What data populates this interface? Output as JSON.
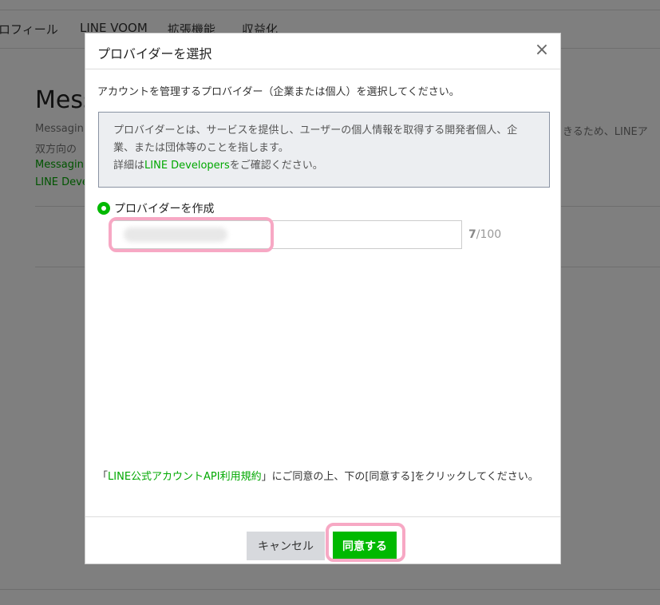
{
  "background": {
    "nav": [
      "ロフィール",
      "LINE VOOM",
      "拡張機能",
      "収益化"
    ],
    "title": "Mess",
    "desc_line1": "Messagin",
    "desc_line2": "双方向の",
    "desc_right": "きるため、LINEア",
    "link1": "Messagin",
    "link2": "LINE Deve"
  },
  "modal": {
    "title": "プロバイダーを選択",
    "close_icon": "×",
    "intro": "アカウントを管理するプロバイダー（企業または個人）を選択してください。",
    "info": {
      "text": "プロバイダーとは、サービスを提供し、ユーザーの個人情報を取得する開発者個人、企業、または団体等のことを指します。",
      "detail_prefix": "詳細は",
      "detail_link": "LINE Developers",
      "detail_suffix": "をご確認ください。"
    },
    "radio_label": "プロバイダーを作成",
    "input_value": "",
    "counter_value": "7",
    "counter_max": "/100",
    "terms": {
      "open_quote": "「",
      "link": "LINE公式アカウントAPI利用規約",
      "rest": "」にご同意の上、下の[同意する]をクリックしてください。"
    },
    "cancel_label": "キャンセル",
    "agree_label": "同意する"
  },
  "colors": {
    "accent": "#00b900",
    "link": "#00a800",
    "highlight": "#f7a8c4"
  }
}
